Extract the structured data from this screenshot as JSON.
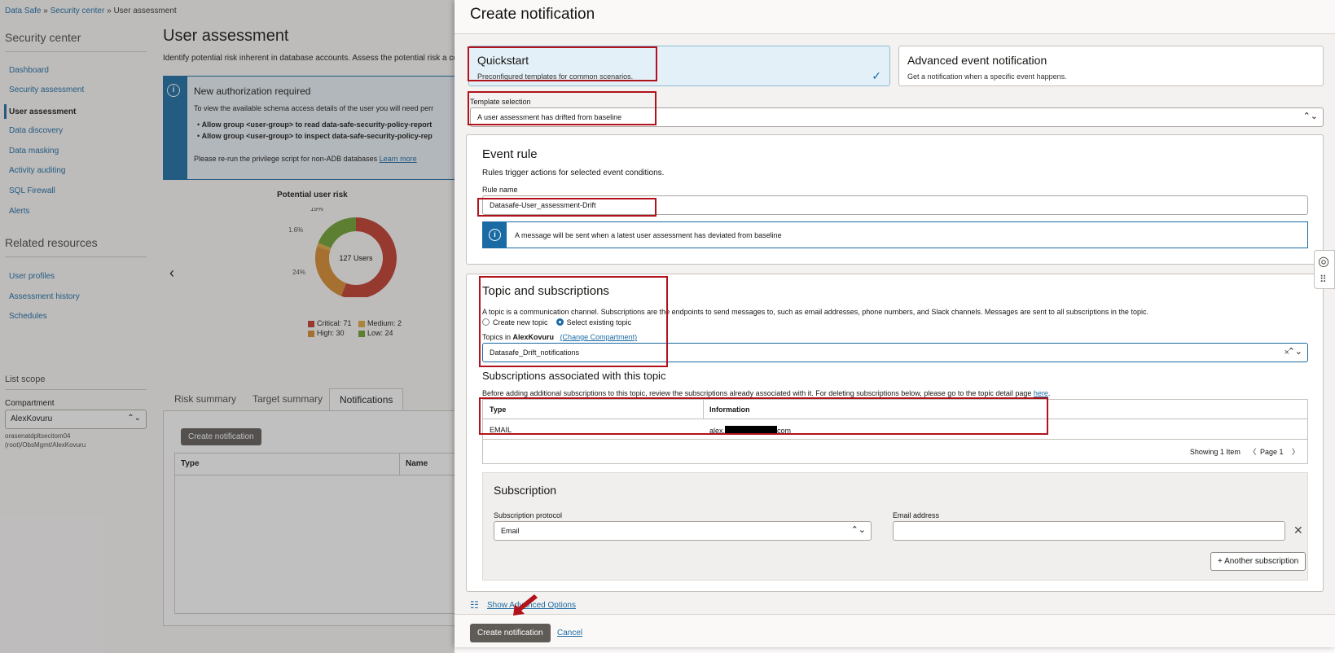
{
  "breadcrumb": {
    "items": [
      "Data Safe",
      "Security center",
      "User assessment"
    ],
    "sep": " » "
  },
  "sidebar": {
    "heading": "Security center",
    "items": [
      {
        "label": "Dashboard"
      },
      {
        "label": "Security assessment"
      },
      {
        "label": "User assessment",
        "active": true
      },
      {
        "label": "Data discovery"
      },
      {
        "label": "Data masking"
      },
      {
        "label": "Activity auditing"
      },
      {
        "label": "SQL Firewall"
      },
      {
        "label": "Alerts"
      }
    ],
    "related_heading": "Related resources",
    "related": [
      {
        "label": "User profiles"
      },
      {
        "label": "Assessment history"
      },
      {
        "label": "Schedules"
      }
    ],
    "scope_heading": "List scope",
    "compartment_label": "Compartment",
    "compartment_value": "AlexKovuru",
    "compartment_path": "orasenatdpltsecitom04 (root)/ObsMgmt/AlexKovuru"
  },
  "main": {
    "title": "User assessment",
    "description": "Identify potential risk inherent in database accounts. Assess the potential risk a cor",
    "banner": {
      "title": "New authorization required",
      "line1": "To view the available schema access details of the user you will need perr",
      "bullet1": "Allow group <user-group> to read data-safe-security-policy-report",
      "bullet2": "Allow group <user-group> to inspect data-safe-security-policy-rep",
      "line2": "Please re-run the privilege script for non-ADB databases",
      "link": "Learn more"
    },
    "tabs": [
      {
        "label": "Risk summary"
      },
      {
        "label": "Target summary"
      },
      {
        "label": "Notifications",
        "active": true
      }
    ],
    "create_button": "Create notification",
    "table_headers": [
      "Type",
      "Name"
    ]
  },
  "chart_data": {
    "type": "pie",
    "title": "Potential user risk",
    "center_label": "127 Users",
    "slices": [
      {
        "name": "Critical",
        "value": 71,
        "label": "56%",
        "color": "#c23a2b"
      },
      {
        "name": "High",
        "value": 30,
        "label": "24%",
        "color": "#d98b2b"
      },
      {
        "name": "Medium",
        "value": 2,
        "label": "1.6%",
        "color": "#e0a840"
      },
      {
        "name": "Low",
        "value": 24,
        "label": "19%",
        "color": "#6e9f2e"
      }
    ],
    "legend": [
      "Critical: 71",
      "Medium: 2",
      "High: 30",
      "Low: 24"
    ]
  },
  "drawer": {
    "title": "Create notification",
    "options": [
      {
        "title": "Quickstart",
        "desc": "Preconfigured templates for common scenarios.",
        "selected": true
      },
      {
        "title": "Advanced event notification",
        "desc": "Get a notification when a specific event happens."
      }
    ],
    "template_label": "Template selection",
    "template_value": "A user assessment has drifted from baseline",
    "event_rule": {
      "title": "Event rule",
      "desc": "Rules trigger actions for selected event conditions.",
      "rule_name_label": "Rule name",
      "rule_name_value": "Datasafe-User_assessment-Drift",
      "info": "A message will be sent when a latest user assessment has deviated from baseline"
    },
    "topic": {
      "title": "Topic and subscriptions",
      "desc": "A topic is a communication channel. Subscriptions are the endpoints to send messages to, such as email addresses, phone numbers, and Slack channels. Messages are sent to all subscriptions in the topic.",
      "radio_new": "Create new topic",
      "radio_existing": "Select existing topic",
      "topics_in": "Topics in",
      "compartment": "AlexKovuru",
      "change_link": "(Change Compartment)",
      "topic_value": "Datasafe_Drift_notifications",
      "subs_heading": "Subscriptions associated with this topic",
      "subs_desc": "Before adding additional subscriptions to this topic, review the subscriptions already associated with it. For deleting subscriptions below, please go to the topic detail page",
      "subs_link": "here",
      "table_headers": [
        "Type",
        "Information"
      ],
      "rows": [
        {
          "type": "EMAIL",
          "info_prefix": "alex.",
          "info_suffix": "com"
        }
      ],
      "showing": "Showing 1 Item",
      "page": "Page 1"
    },
    "subscription": {
      "title": "Subscription",
      "protocol_label": "Subscription protocol",
      "protocol_value": "Email",
      "email_label": "Email address",
      "email_value": "",
      "another": "+ Another subscription"
    },
    "advanced_link": "Show Advanced Options",
    "primary": "Create notification",
    "cancel": "Cancel"
  }
}
